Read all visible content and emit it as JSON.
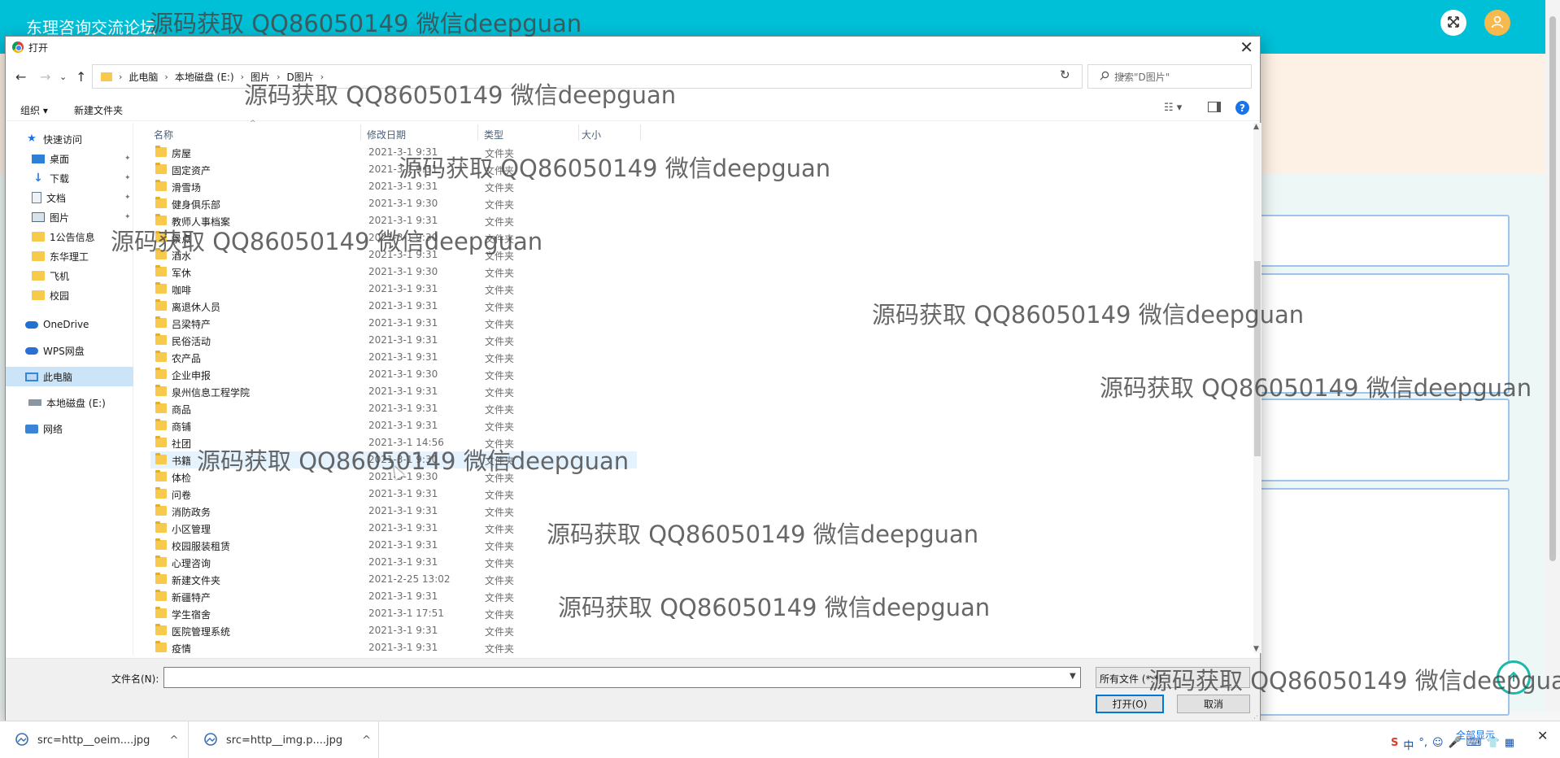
{
  "site": {
    "title": "东理咨询交流论坛"
  },
  "dialog": {
    "title": "打开",
    "close_glyph": "✕",
    "nav": {
      "back": "←",
      "forward": "→",
      "dropdown": "⌄",
      "up": "↑"
    },
    "breadcrumb": [
      "此电脑",
      "本地磁盘 (E:)",
      "图片",
      "D图片"
    ],
    "breadcrumb_sep": "›",
    "refresh_glyph": "↻",
    "search_placeholder": "搜索\"D图片\"",
    "toolbar": {
      "organize": "组织 ▾",
      "new_folder": "新建文件夹",
      "view": "☷ ▾",
      "help": "?"
    },
    "sidebar": [
      {
        "label": "快速访问",
        "icon": "star-icon"
      },
      {
        "label": "桌面",
        "icon": "desktop-icon",
        "pinned": true
      },
      {
        "label": "下载",
        "icon": "download-icon",
        "pinned": true
      },
      {
        "label": "文档",
        "icon": "document-icon",
        "pinned": true
      },
      {
        "label": "图片",
        "icon": "pictures-icon",
        "pinned": true
      },
      {
        "label": "1公告信息",
        "icon": "folder-icon"
      },
      {
        "label": "东华理工",
        "icon": "folder-icon"
      },
      {
        "label": "飞机",
        "icon": "folder-icon"
      },
      {
        "label": "校园",
        "icon": "folder-icon"
      },
      {
        "label": "OneDrive",
        "icon": "onedrive-icon"
      },
      {
        "label": "WPS网盘",
        "icon": "wps-cloud-icon"
      },
      {
        "label": "此电脑",
        "icon": "this-pc-icon",
        "selected": true
      },
      {
        "label": "本地磁盘 (E:)",
        "icon": "drive-icon"
      },
      {
        "label": "网络",
        "icon": "network-icon"
      }
    ],
    "pin_glyph": "📌",
    "columns": {
      "name": "名称",
      "modified": "修改日期",
      "type": "类型",
      "size": "大小"
    },
    "files": [
      {
        "name": "房屋",
        "date": "2021-3-1 9:31",
        "type": "文件夹"
      },
      {
        "name": "固定资产",
        "date": "2021-3-1 9:31",
        "type": "文件夹"
      },
      {
        "name": "滑雪场",
        "date": "2021-3-1 9:31",
        "type": "文件夹"
      },
      {
        "name": "健身俱乐部",
        "date": "2021-3-1 9:30",
        "type": "文件夹"
      },
      {
        "name": "教师人事档案",
        "date": "2021-3-1 9:31",
        "type": "文件夹"
      },
      {
        "name": "景点",
        "date": "2021-3-1 9:30",
        "type": "文件夹"
      },
      {
        "name": "酒水",
        "date": "2021-3-1 9:31",
        "type": "文件夹"
      },
      {
        "name": "军休",
        "date": "2021-3-1 9:30",
        "type": "文件夹"
      },
      {
        "name": "咖啡",
        "date": "2021-3-1 9:31",
        "type": "文件夹"
      },
      {
        "name": "离退休人员",
        "date": "2021-3-1 9:31",
        "type": "文件夹"
      },
      {
        "name": "吕梁特产",
        "date": "2021-3-1 9:31",
        "type": "文件夹"
      },
      {
        "name": "民俗活动",
        "date": "2021-3-1 9:31",
        "type": "文件夹"
      },
      {
        "name": "农产品",
        "date": "2021-3-1 9:31",
        "type": "文件夹"
      },
      {
        "name": "企业申报",
        "date": "2021-3-1 9:30",
        "type": "文件夹"
      },
      {
        "name": "泉州信息工程学院",
        "date": "2021-3-1 9:31",
        "type": "文件夹"
      },
      {
        "name": "商品",
        "date": "2021-3-1 9:31",
        "type": "文件夹"
      },
      {
        "name": "商铺",
        "date": "2021-3-1 9:31",
        "type": "文件夹"
      },
      {
        "name": "社团",
        "date": "2021-3-1 14:56",
        "type": "文件夹"
      },
      {
        "name": "书籍",
        "date": "2021-3-1 9:30",
        "type": "文件夹"
      },
      {
        "name": "体检",
        "date": "2021-3-1 9:30",
        "type": "文件夹"
      },
      {
        "name": "问卷",
        "date": "2021-3-1 9:31",
        "type": "文件夹"
      },
      {
        "name": "消防政务",
        "date": "2021-3-1 9:31",
        "type": "文件夹"
      },
      {
        "name": "小区管理",
        "date": "2021-3-1 9:31",
        "type": "文件夹"
      },
      {
        "name": "校园服装租赁",
        "date": "2021-3-1 9:31",
        "type": "文件夹"
      },
      {
        "name": "心理咨询",
        "date": "2021-3-1 9:31",
        "type": "文件夹"
      },
      {
        "name": "新建文件夹",
        "date": "2021-2-25 13:02",
        "type": "文件夹"
      },
      {
        "name": "新疆特产",
        "date": "2021-3-1 9:31",
        "type": "文件夹"
      },
      {
        "name": "学生宿舍",
        "date": "2021-3-1 17:51",
        "type": "文件夹"
      },
      {
        "name": "医院管理系统",
        "date": "2021-3-1 9:31",
        "type": "文件夹"
      },
      {
        "name": "疫情",
        "date": "2021-3-1 9:31",
        "type": "文件夹"
      }
    ],
    "hovered_file": "书籍",
    "filename_label": "文件名(N):",
    "filename_value": "",
    "filetype_value": "所有文件 (*.*)",
    "open_button": "打开(O)",
    "cancel_button": "取消"
  },
  "downloads": {
    "items": [
      {
        "name": "src=http__oeim....jpg"
      },
      {
        "name": "src=http__img.p....jpg"
      }
    ],
    "chevron": "^",
    "show_all": "全部显示",
    "close": "✕"
  },
  "tray": [
    "S",
    "中",
    "°,",
    "☺",
    "🎤",
    "⌨",
    "👕",
    "▦"
  ],
  "watermark_text": "源码获取 QQ86050149 微信deepguan",
  "colors": {
    "header_bg": "#00c0d8",
    "selection": "#cce4f7",
    "hover": "#e5f3ff",
    "folder": "#f7c94c",
    "accent": "#0078d7"
  }
}
